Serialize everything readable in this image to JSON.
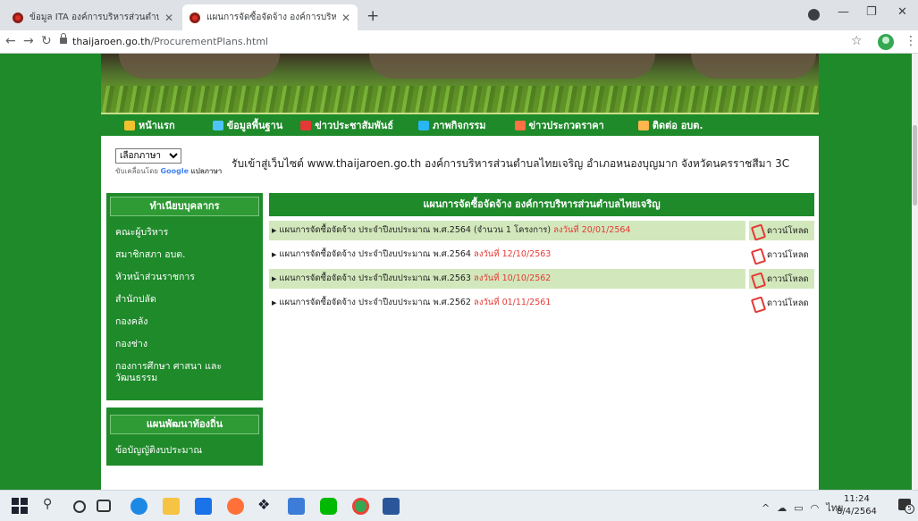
{
  "browser": {
    "tabs": [
      {
        "title": "ข้อมูล ITA องค์การบริหารส่วนตำบลไทยเจริญ",
        "active": false
      },
      {
        "title": "แผนการจัดซื้อจัดจ้าง องค์การบริหารส่วนตำบล",
        "active": true
      }
    ],
    "new_tab": "+",
    "url_host": "thaijaroen.go.th",
    "url_path": "/ProcurementPlans.html",
    "icons": {
      "back": "arrow-left-icon",
      "forward": "arrow-right-icon",
      "reload": "reload-icon",
      "lock": "lock-icon",
      "star": "star-icon",
      "menu": "kebab-icon"
    }
  },
  "nav": {
    "items": [
      {
        "label": "หน้าแรก",
        "icon_color": "#f2c12e"
      },
      {
        "label": "ข้อมูลพื้นฐาน",
        "icon_color": "#4fc3f7"
      },
      {
        "label": "ข่าวประชาสัมพันธ์",
        "icon_color": "#e53935"
      },
      {
        "label": "ภาพกิจกรรม",
        "icon_color": "#29b6f6"
      },
      {
        "label": "ข่าวประกวดราคา",
        "icon_color": "#ff7043"
      },
      {
        "label": "ติดต่อ อบต.",
        "icon_color": "#ffb74d"
      }
    ]
  },
  "translate": {
    "select_value": "เลือกภาษา",
    "powered_prefix": "ขับเคลื่อนโดย",
    "google": "Google",
    "translate_word": "แปลภาษา"
  },
  "marquee": "รับเข้าสู่เว็บไซต์ www.thaijaroen.go.th องค์การบริหารส่วนตำบลไทยเจริญ อำเภอหนองบุญมาก จังหวัดนครราชสีมา 3C",
  "sidebar": {
    "section1_title": "ทำเนียบบุคลากร",
    "section1_items": [
      "คณะผู้บริหาร",
      "สมาชิกสภา อบต.",
      "หัวหน้าส่วนราชการ",
      "สำนักปลัด",
      "กองคลัง",
      "กองช่าง",
      "กองการศึกษา ศาสนา และวัฒนธรรม"
    ],
    "section2_title": "แผนพัฒนาท้องถิ่น",
    "section2_items": [
      "ข้อบัญญัติงบประมาณ"
    ]
  },
  "main": {
    "title": "แผนการจัดซื้อจัดจ้าง องค์การบริหารส่วนตำบลไทยเจริญ",
    "download_label": "ดาวน์โหลด",
    "rows": [
      {
        "text": "แผนการจัดซื้อจัดจ้าง ประจำปีงบประมาณ พ.ศ.2564 (จำนวน 1 โครงการ)",
        "date": "ลงวันที่ 20/01/2564"
      },
      {
        "text": "แผนการจัดซื้อจัดจ้าง ประจำปีงบประมาณ พ.ศ.2564",
        "date": "ลงวันที่ 12/10/2563"
      },
      {
        "text": "แผนการจัดซื้อจัดจ้าง ประจำปีงบประมาณ พ.ศ.2563",
        "date": "ลงวันที่ 10/10/2562"
      },
      {
        "text": "แผนการจัดซื้อจัดจ้าง ประจำปีงบประมาณ พ.ศ.2562",
        "date": "ลงวันที่ 01/11/2561"
      }
    ]
  },
  "taskbar": {
    "lang": "ไทย",
    "time": "11:24",
    "date": "8/4/2564",
    "notif_count": "5"
  }
}
